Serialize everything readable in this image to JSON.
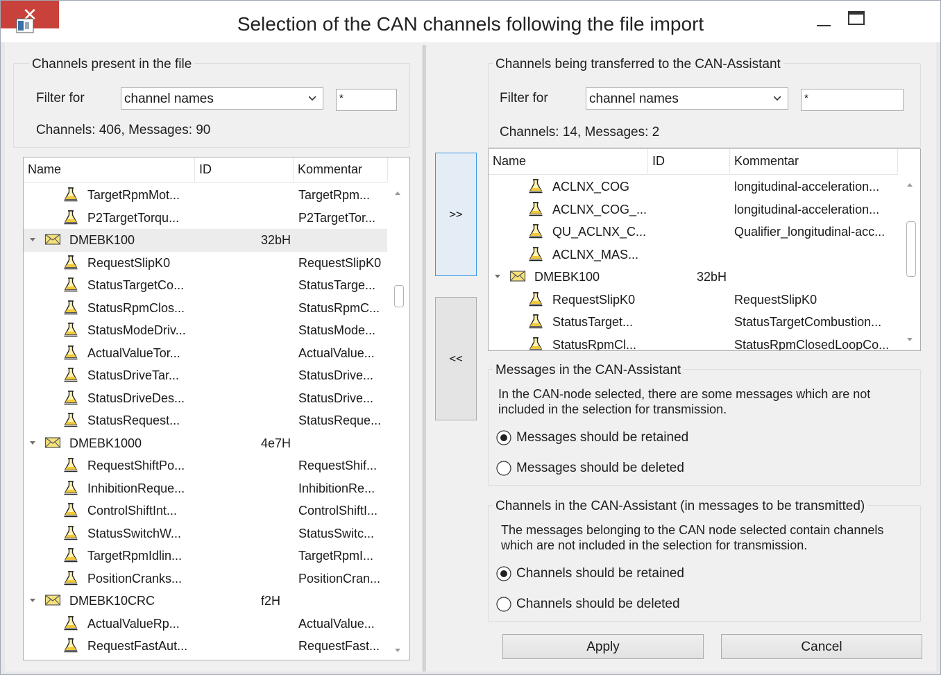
{
  "window": {
    "title": "Selection of the CAN channels following the file import",
    "close_glyph": "✕"
  },
  "left": {
    "group_title": "Channels present in the file",
    "filter_label": "Filter for",
    "filter_value": "channel names",
    "filter_text": "*",
    "summary": "Channels: 406, Messages: 90",
    "columns": [
      "Name",
      "ID",
      "Kommentar"
    ],
    "rows": [
      {
        "type": "channel",
        "name": "TargetRpmMot...",
        "id": "",
        "comment": "TargetRpm..."
      },
      {
        "type": "channel",
        "name": "P2TargetTorqu...",
        "id": "",
        "comment": "P2TargetTor..."
      },
      {
        "type": "message",
        "name": "DMEBK100",
        "id": "32bH",
        "comment": "",
        "selected": true
      },
      {
        "type": "channel",
        "name": "RequestSlipK0",
        "id": "",
        "comment": "RequestSlipK0"
      },
      {
        "type": "channel",
        "name": "StatusTargetCo...",
        "id": "",
        "comment": "StatusTarge..."
      },
      {
        "type": "channel",
        "name": "StatusRpmClos...",
        "id": "",
        "comment": "StatusRpmC..."
      },
      {
        "type": "channel",
        "name": "StatusModeDriv...",
        "id": "",
        "comment": "StatusMode..."
      },
      {
        "type": "channel",
        "name": "ActualValueTor...",
        "id": "",
        "comment": "ActualValue..."
      },
      {
        "type": "channel",
        "name": "StatusDriveTar...",
        "id": "",
        "comment": "StatusDrive..."
      },
      {
        "type": "channel",
        "name": "StatusDriveDes...",
        "id": "",
        "comment": "StatusDrive..."
      },
      {
        "type": "channel",
        "name": "StatusRequest...",
        "id": "",
        "comment": "StatusReque..."
      },
      {
        "type": "message",
        "name": "DMEBK1000",
        "id": "4e7H",
        "comment": ""
      },
      {
        "type": "channel",
        "name": "RequestShiftPo...",
        "id": "",
        "comment": "RequestShif..."
      },
      {
        "type": "channel",
        "name": "InhibitionReque...",
        "id": "",
        "comment": "InhibitionRe..."
      },
      {
        "type": "channel",
        "name": "ControlShiftInt...",
        "id": "",
        "comment": "ControlShiftI..."
      },
      {
        "type": "channel",
        "name": "StatusSwitchW...",
        "id": "",
        "comment": "StatusSwitc..."
      },
      {
        "type": "channel",
        "name": "TargetRpmIdlin...",
        "id": "",
        "comment": "TargetRpmI..."
      },
      {
        "type": "channel",
        "name": "PositionCranks...",
        "id": "",
        "comment": "PositionCran..."
      },
      {
        "type": "message",
        "name": "DMEBK10CRC",
        "id": "f2H",
        "comment": ""
      },
      {
        "type": "channel",
        "name": "ActualValueRp...",
        "id": "",
        "comment": "ActualValue..."
      },
      {
        "type": "channel",
        "name": "RequestFastAut...",
        "id": "",
        "comment": "RequestFast..."
      }
    ]
  },
  "transfer": {
    "add_label": ">>",
    "remove_label": "<<"
  },
  "right": {
    "group_title": "Channels being transferred to the CAN-Assistant",
    "filter_label": "Filter for",
    "filter_value": "channel names",
    "filter_text": "*",
    "summary": "Channels: 14, Messages: 2",
    "columns": [
      "Name",
      "ID",
      "Kommentar"
    ],
    "rows": [
      {
        "type": "channel",
        "name": "ACLNX_COG",
        "id": "",
        "comment": "longitudinal-acceleration..."
      },
      {
        "type": "channel",
        "name": "ACLNX_COG_...",
        "id": "",
        "comment": "longitudinal-acceleration..."
      },
      {
        "type": "channel",
        "name": "QU_ACLNX_C...",
        "id": "",
        "comment": "Qualifier_longitudinal-acc..."
      },
      {
        "type": "channel",
        "name": "ACLNX_MAS...",
        "id": "",
        "comment": ""
      },
      {
        "type": "message",
        "name": "DMEBK100",
        "id": "32bH",
        "comment": ""
      },
      {
        "type": "channel",
        "name": "RequestSlipK0",
        "id": "",
        "comment": "RequestSlipK0"
      },
      {
        "type": "channel",
        "name": "StatusTarget...",
        "id": "",
        "comment": "StatusTargetCombustion..."
      },
      {
        "type": "channel",
        "name": "StatusRpmCl...",
        "id": "",
        "comment": "StatusRpmClosedLoopCo..."
      }
    ]
  },
  "messages_group": {
    "title": "Messages in the CAN-Assistant",
    "description": "In the CAN-node selected, there are some messages which are not included in the selection for transmission.",
    "options": [
      {
        "label": "Messages should be retained",
        "checked": true
      },
      {
        "label": "Messages should be deleted",
        "checked": false
      }
    ]
  },
  "channels_group": {
    "title": "Channels in the CAN-Assistant (in messages to be transmitted)",
    "description": "The messages belonging to the CAN node selected contain channels which are not included in the selection for transmission.",
    "options": [
      {
        "label": "Channels should be retained",
        "checked": true
      },
      {
        "label": "Channels should be deleted",
        "checked": false
      }
    ]
  },
  "actions": {
    "apply_label": "Apply",
    "cancel_label": "Cancel"
  },
  "icons": {
    "message": "envelope-icon",
    "channel": "signal-flask-icon",
    "expand": "chevron-down-icon"
  }
}
